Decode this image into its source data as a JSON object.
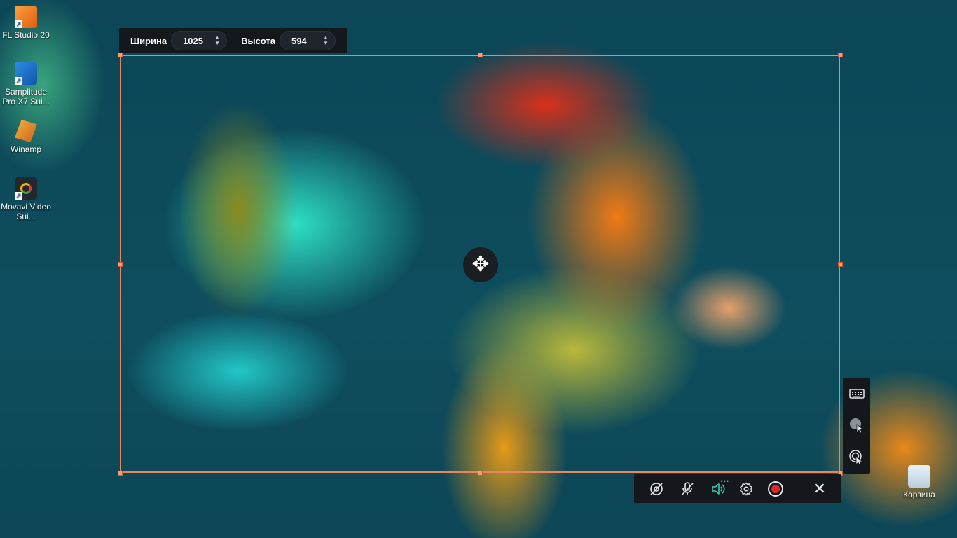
{
  "desktop": {
    "icons": [
      {
        "label": "FL Studio 20",
        "icon": "fl-studio-icon"
      },
      {
        "label": "Samplitude Pro X7 Sui...",
        "icon": "samplitude-icon"
      },
      {
        "label": "Winamp",
        "icon": "winamp-icon"
      },
      {
        "label": "Movavi Video Sui...",
        "icon": "movavi-icon"
      },
      {
        "label": "Корзина",
        "icon": "recycle-bin-icon"
      }
    ],
    "shortcut_arrow": "↗"
  },
  "size_panel": {
    "width_label": "Ширина",
    "width_value": "1025",
    "height_label": "Высота",
    "height_value": "594",
    "spin_up": "▲",
    "spin_down": "▼"
  },
  "selection": {
    "move_glyph": "✥",
    "frame_color": "#e8875f"
  },
  "side_panel": {
    "buttons": [
      "keyboard-icon",
      "cursor-highlight-icon",
      "click-effect-icon"
    ]
  },
  "toolbar": {
    "buttons": [
      "webcam-off-icon",
      "microphone-off-icon",
      "speaker-icon",
      "settings-icon",
      "record-button",
      "close-icon"
    ],
    "close_glyph": "✕",
    "speaker_dots": "•••",
    "accent_color": "#2fd3b5",
    "record_color": "#e0262d"
  }
}
